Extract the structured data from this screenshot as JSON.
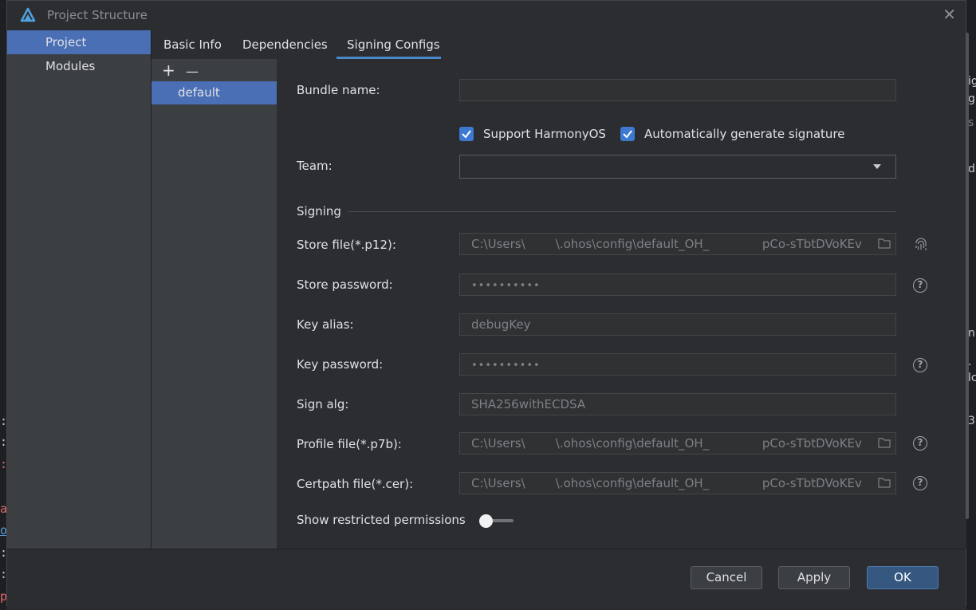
{
  "window": {
    "title": "Project Structure"
  },
  "sidebar": {
    "items": [
      {
        "label": "Project"
      },
      {
        "label": "Modules"
      }
    ]
  },
  "tabs": [
    {
      "label": "Basic Info"
    },
    {
      "label": "Dependencies"
    },
    {
      "label": "Signing Configs"
    }
  ],
  "configs": {
    "add": "+",
    "remove": "—",
    "items": [
      {
        "label": "default"
      }
    ]
  },
  "form": {
    "bundle_name_label": "Bundle name:",
    "support_harmony_label": "Support HarmonyOS",
    "auto_sign_label": "Automatically generate signature",
    "team_label": "Team:",
    "signing_section": "Signing",
    "store_file_label": "Store file(*.p12):",
    "store_file_value": "C:\\Users\\        \\.ohos\\config\\default_OH_              pCo-sTbtDVoKEv",
    "store_password_label": "Store password:",
    "store_password_value": "••••••••••",
    "key_alias_label": "Key alias:",
    "key_alias_value": "debugKey",
    "key_password_label": "Key password:",
    "key_password_value": "••••••••••",
    "sign_alg_label": "Sign alg:",
    "sign_alg_value": "SHA256withECDSA",
    "profile_file_label": "Profile file(*.p7b):",
    "profile_file_value": "C:\\Users\\        \\.ohos\\config\\default_OH_              pCo-sTbtDVoKEv",
    "certpath_file_label": "Certpath file(*.cer):",
    "certpath_file_value": "C:\\Users\\        \\.ohos\\config\\default_OH_              pCo-sTbtDVoKEv",
    "restricted_label": "Show restricted permissions",
    "help_glyph": "?"
  },
  "footer": {
    "cancel": "Cancel",
    "apply": "Apply",
    "ok": "OK"
  },
  "background": {
    "left_glyphs": [
      ":",
      ":",
      ":",
      "a",
      "o",
      ":",
      ":",
      "p"
    ],
    "right_glyphs": [
      "ig",
      "g",
      "s",
      "d",
      "ni",
      ".",
      "lc",
      "3"
    ]
  },
  "colors": {
    "accent": "#4a6fb5",
    "checkbox": "#3d78d1",
    "primary_button": "#365880"
  },
  "icons": [
    "app-logo-icon",
    "close-icon",
    "folder-icon",
    "fingerprint-icon",
    "help-icon",
    "dropdown-arrow-icon",
    "check-icon"
  ]
}
